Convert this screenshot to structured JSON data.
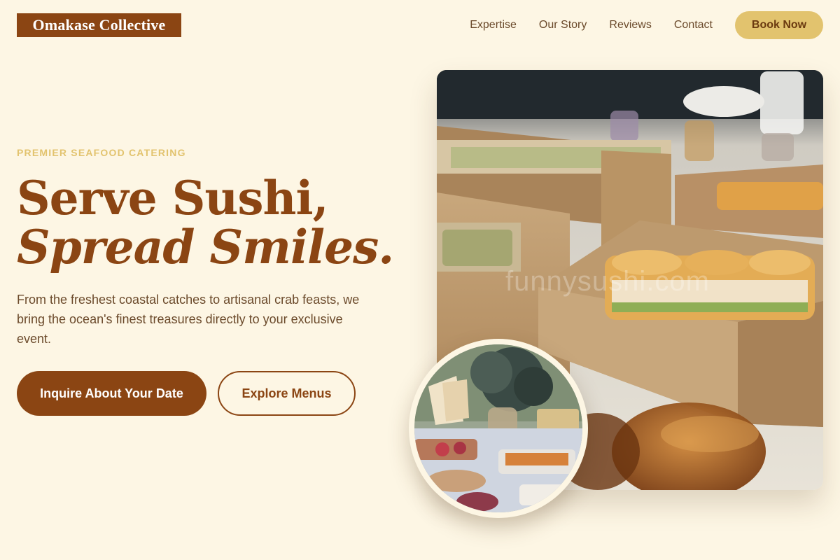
{
  "header": {
    "logo_text": "Omakase Collective",
    "nav": [
      "Expertise",
      "Our Story",
      "Reviews",
      "Contact"
    ],
    "cta_label": "Book Now"
  },
  "hero": {
    "eyebrow": "PREMIER SEAFOOD CATERING",
    "headline_line1": "Serve Sushi,",
    "headline_line2": "Spread Smiles.",
    "description": "From the freshest coastal catches to artisanal crab feasts, we bring the ocean's finest treasures directly to your exclusive event.",
    "primary_button": "Inquire About Your Date",
    "secondary_button": "Explore Menus"
  },
  "images": {
    "main_photo": "catering-boxes-photo",
    "inset_photo": "buffet-table-photo",
    "watermark": "funnysushi.com"
  },
  "colors": {
    "background": "#fdf6e4",
    "brand_brown": "#8b4513",
    "accent_gold": "#e2c36e",
    "text_body": "#6b4a2b"
  }
}
